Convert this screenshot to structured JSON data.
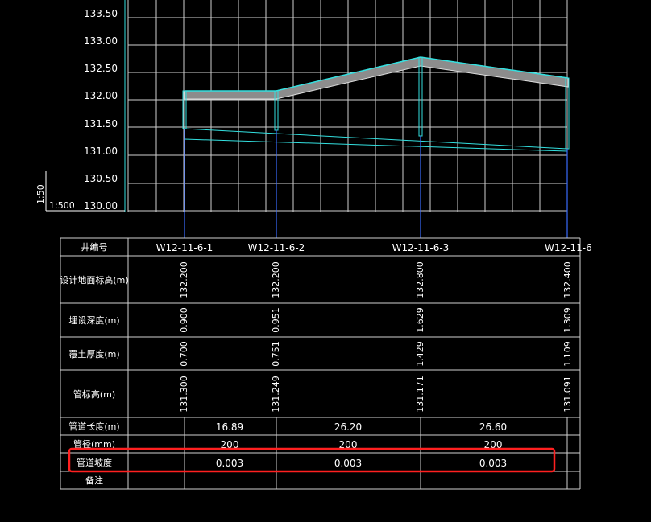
{
  "profile": {
    "y_axis_ticks": [
      "133.50",
      "133.00",
      "132.50",
      "132.00",
      "131.50",
      "131.00",
      "130.50",
      "130.00"
    ],
    "vertical_scale": "1:50",
    "horizontal_scale": "1:500",
    "colors": {
      "grid": "#cfcfcf",
      "pipe": "#33e0e0",
      "ground_hatch": "#bbbbbb",
      "highlight": "#ff2020",
      "table_line": "#d0d0d0"
    }
  },
  "table": {
    "labels": {
      "well_id": "井编号",
      "ground_elev": "设计地面标高(m)",
      "burial_depth": "埋设深度(m)",
      "cover_depth": "覆土厚度(m)",
      "pipe_elev": "管标高(m)",
      "pipe_length": "管道长度(m)",
      "diameter": "管径(mm)",
      "slope": "管道坡度",
      "remarks": "备注"
    },
    "wells": [
      {
        "id": "W12-11-6-1",
        "ground_elev": "132.200",
        "burial_depth": "0.900",
        "cover_depth": "0.700",
        "pipe_elev": "131.300"
      },
      {
        "id": "W12-11-6-2",
        "ground_elev": "132.200",
        "burial_depth": "0.951",
        "cover_depth": "0.751",
        "pipe_elev": "131.249"
      },
      {
        "id": "W12-11-6-3",
        "ground_elev": "132.800",
        "burial_depth": "1.629",
        "cover_depth": "1.429",
        "pipe_elev": "131.171"
      },
      {
        "id": "W12-11-6",
        "ground_elev": "132.400",
        "burial_depth": "1.309",
        "cover_depth": "1.109",
        "pipe_elev": "131.091"
      }
    ],
    "segments": [
      {
        "length": "16.89",
        "diameter": "200",
        "slope": "0.003"
      },
      {
        "length": "26.20",
        "diameter": "200",
        "slope": "0.003"
      },
      {
        "length": "26.60",
        "diameter": "200",
        "slope": "0.003"
      }
    ]
  }
}
